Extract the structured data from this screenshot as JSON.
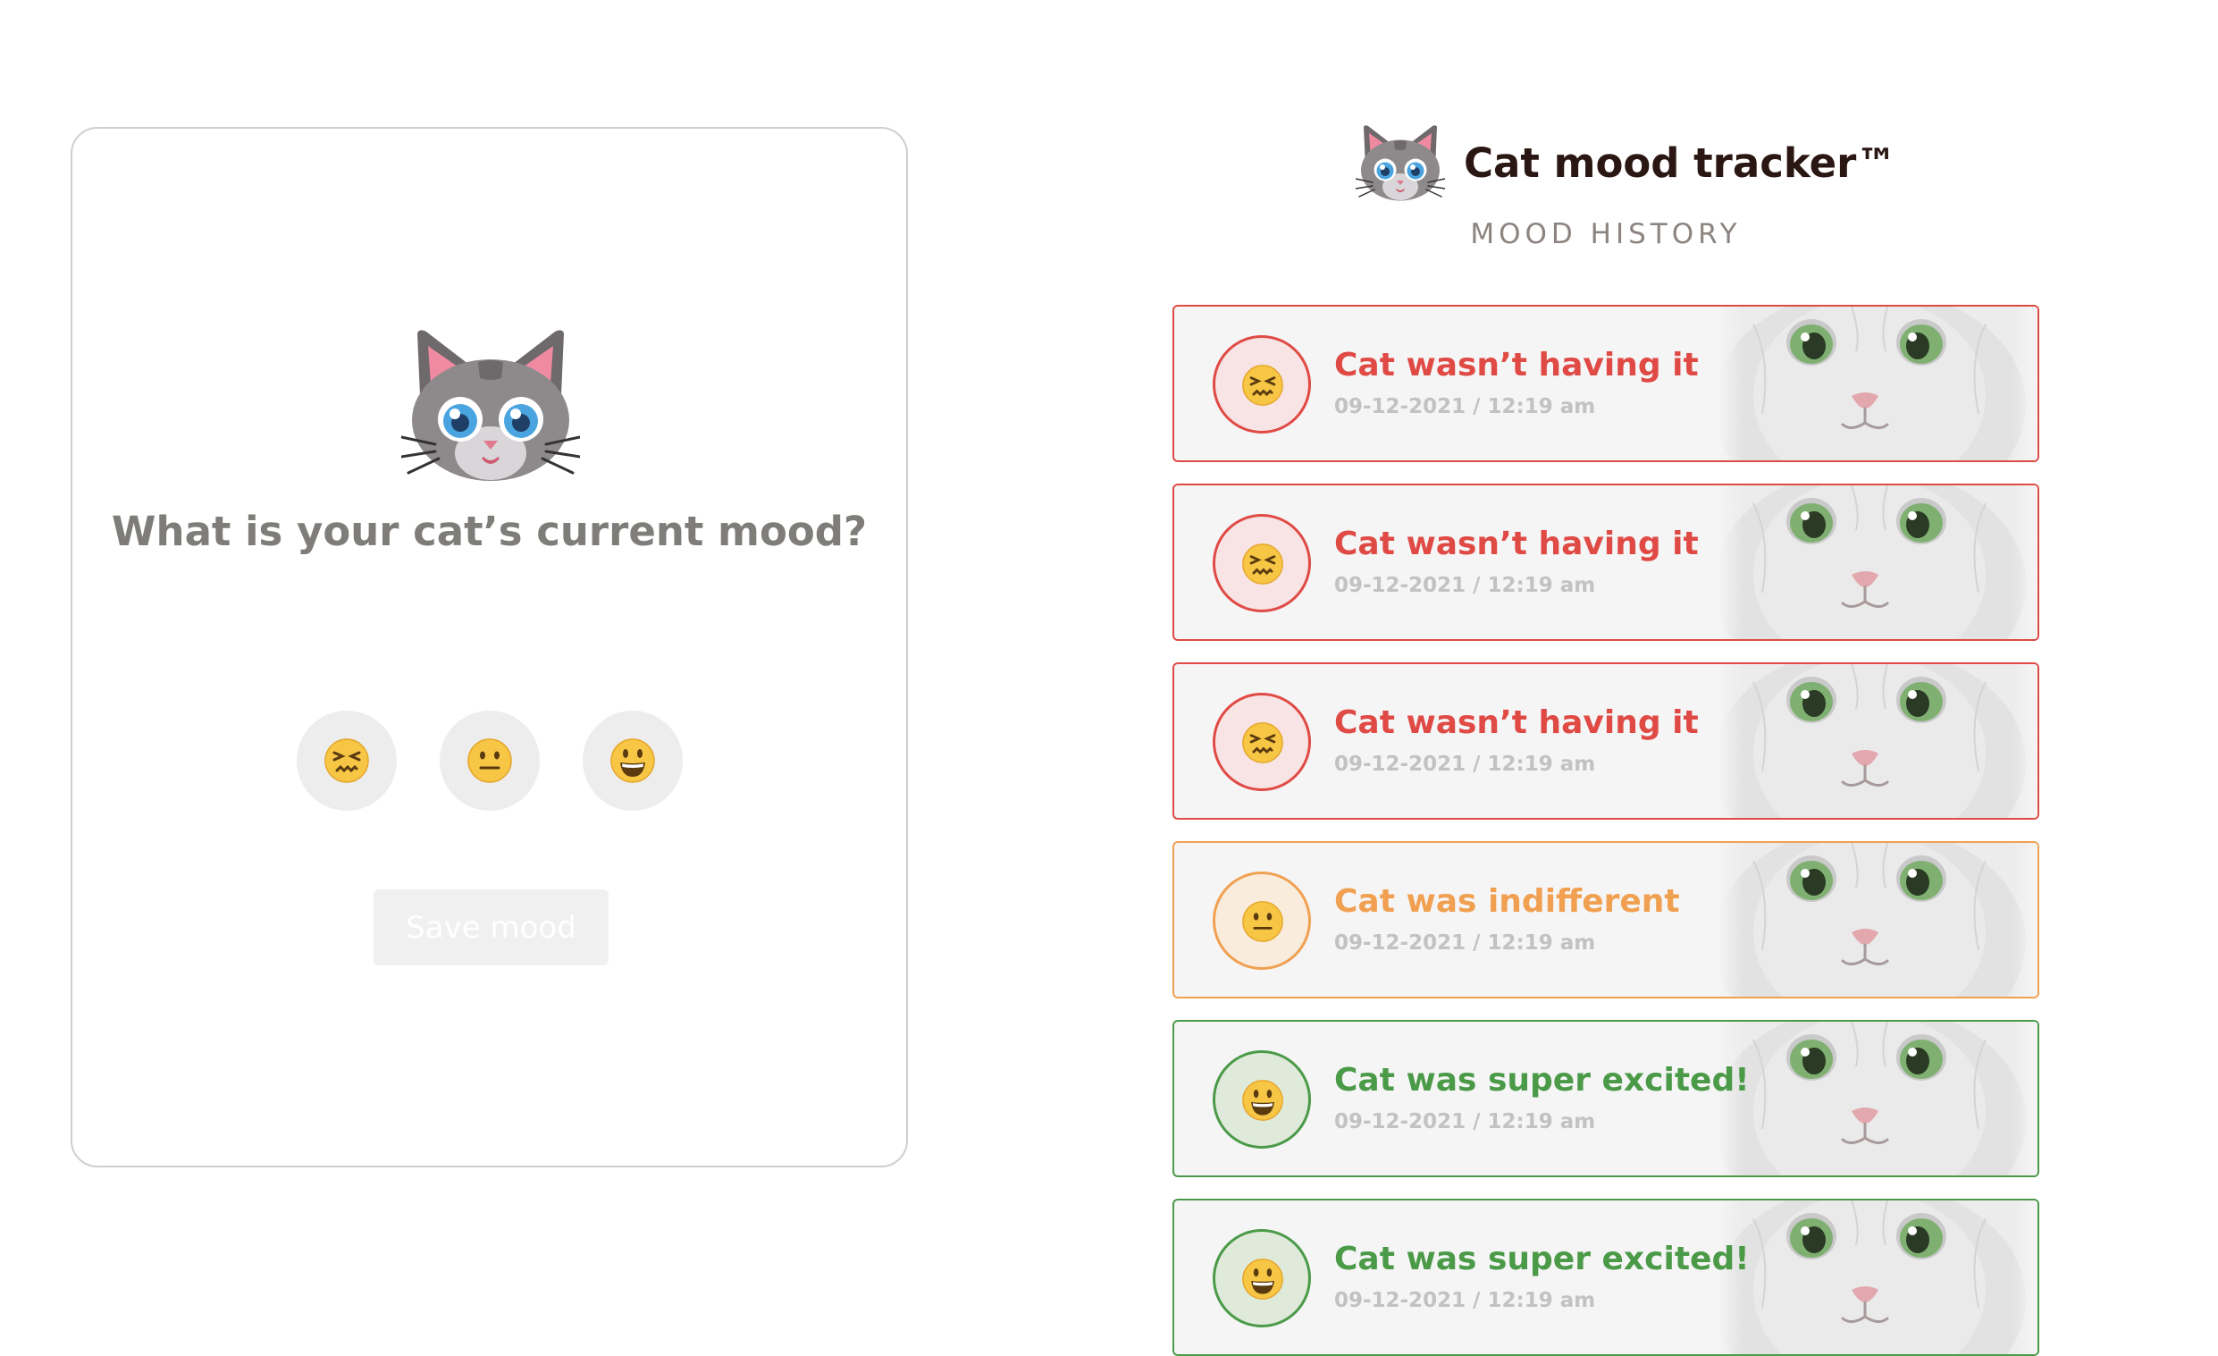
{
  "form": {
    "question": "What is your cat’s current mood?",
    "options": [
      {
        "mood": "tired-face-icon"
      },
      {
        "mood": "neutral-face-icon"
      },
      {
        "mood": "grinning-face-icon"
      }
    ],
    "save_label": "Save mood"
  },
  "header": {
    "title": "Cat mood tracker™",
    "logo_icon": "cat-face-icon"
  },
  "history": {
    "title": "MOOD HISTORY",
    "entries": [
      {
        "label": "Cat wasn’t having it",
        "time": "09-12-2021 / 12:19 am",
        "mood": "negative",
        "icon": "tired-face-icon"
      },
      {
        "label": "Cat wasn’t having it",
        "time": "09-12-2021 / 12:19 am",
        "mood": "negative",
        "icon": "tired-face-icon"
      },
      {
        "label": "Cat wasn’t having it",
        "time": "09-12-2021 / 12:19 am",
        "mood": "negative",
        "icon": "tired-face-icon"
      },
      {
        "label": "Cat was indifferent",
        "time": "09-12-2021 / 12:19 am",
        "mood": "neutral",
        "icon": "neutral-face-icon"
      },
      {
        "label": "Cat was super excited!",
        "time": "09-12-2021 / 12:19 am",
        "mood": "positive",
        "icon": "grinning-face-icon"
      },
      {
        "label": "Cat was super excited!",
        "time": "09-12-2021 / 12:19 am",
        "mood": "positive",
        "icon": "grinning-face-icon"
      }
    ]
  },
  "colors": {
    "negative": "#e04a45",
    "neutral": "#f0a050",
    "positive": "#4b9a48",
    "question_text": "#7f7d7a",
    "title_text": "#2a1612"
  }
}
